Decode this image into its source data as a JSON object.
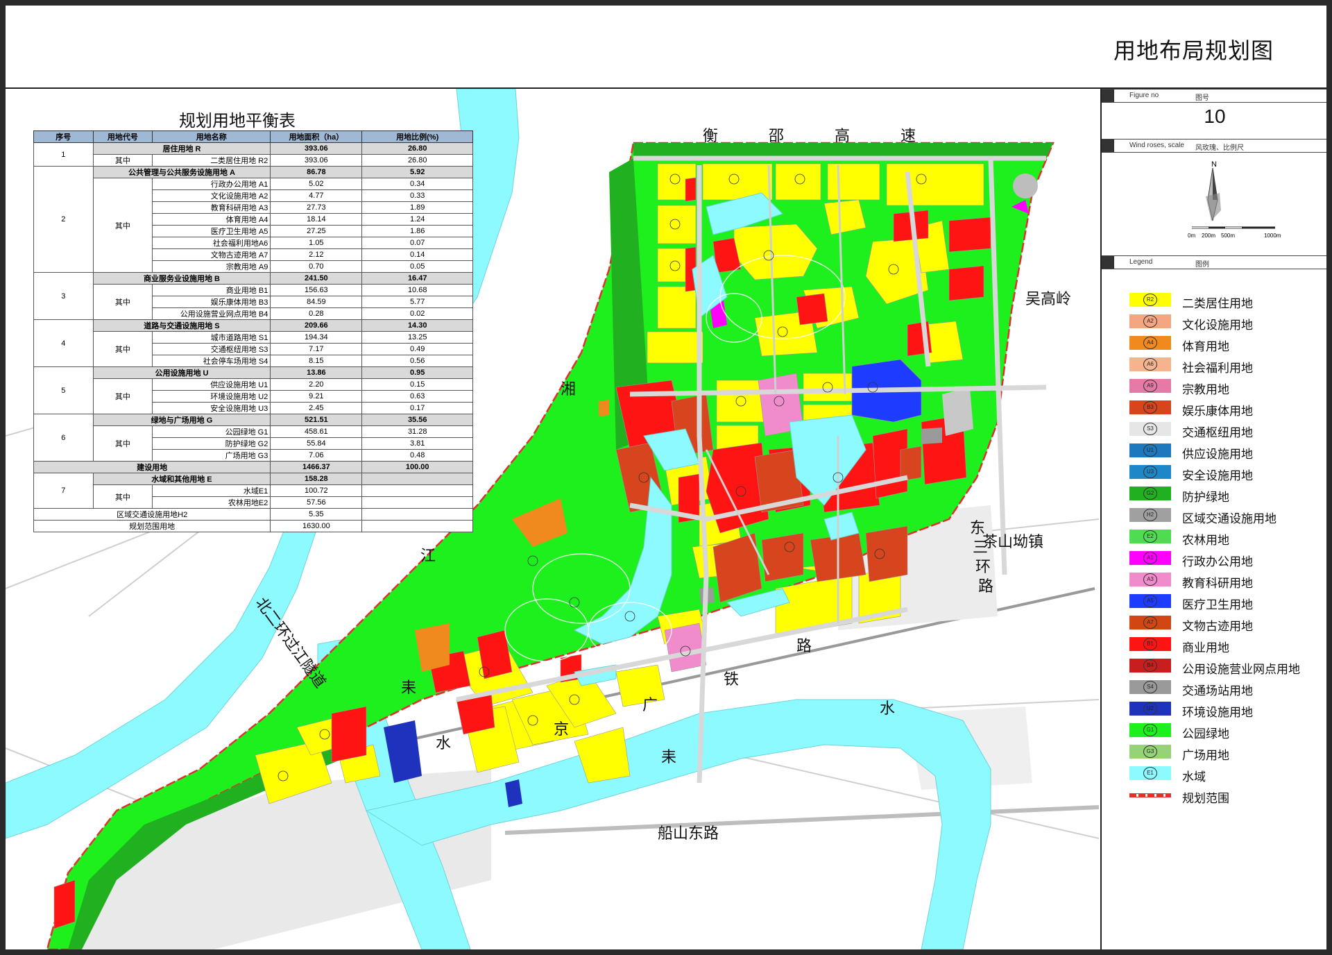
{
  "sheet_title": "用地布局规划图",
  "table": {
    "title": "规划用地平衡表",
    "headers": [
      "序号",
      "用地代号",
      "用地名称",
      "用地面积（ha）",
      "用地比例(%)"
    ],
    "rows": [
      {
        "type": "cat",
        "no": "1",
        "name": "居住用地 R",
        "area": "393.06",
        "ratio": "26.80"
      },
      {
        "type": "sub",
        "group": "其中",
        "name": "二类居住用地 R2",
        "area": "393.06",
        "ratio": "26.80"
      },
      {
        "type": "cat",
        "no": "2",
        "name": "公共管理与公共服务设施用地 A",
        "area": "86.78",
        "ratio": "5.92"
      },
      {
        "type": "sub",
        "group": "其中",
        "name": "行政办公用地 A1",
        "area": "5.02",
        "ratio": "0.34"
      },
      {
        "type": "sub",
        "name": "文化设施用地 A2",
        "area": "4.77",
        "ratio": "0.33"
      },
      {
        "type": "sub",
        "name": "教育科研用地 A3",
        "area": "27.73",
        "ratio": "1.89"
      },
      {
        "type": "sub",
        "name": "体育用地 A4",
        "area": "18.14",
        "ratio": "1.24"
      },
      {
        "type": "sub",
        "name": "医疗卫生用地 A5",
        "area": "27.25",
        "ratio": "1.86"
      },
      {
        "type": "sub",
        "name": "社会福利用地A6",
        "area": "1.05",
        "ratio": "0.07"
      },
      {
        "type": "sub",
        "name": "文物古迹用地 A7",
        "area": "2.12",
        "ratio": "0.14"
      },
      {
        "type": "sub",
        "name": "宗教用地 A9",
        "area": "0.70",
        "ratio": "0.05"
      },
      {
        "type": "cat",
        "no": "3",
        "name": "商业服务业设施用地 B",
        "area": "241.50",
        "ratio": "16.47"
      },
      {
        "type": "sub",
        "group": "其中",
        "name": "商业用地 B1",
        "area": "156.63",
        "ratio": "10.68"
      },
      {
        "type": "sub",
        "name": "娱乐康体用地 B3",
        "area": "84.59",
        "ratio": "5.77"
      },
      {
        "type": "sub",
        "name": "公用设施营业网点用地 B4",
        "area": "0.28",
        "ratio": "0.02"
      },
      {
        "type": "cat",
        "no": "4",
        "name": "道路与交通设施用地 S",
        "area": "209.66",
        "ratio": "14.30"
      },
      {
        "type": "sub",
        "group": "其中",
        "name": "城市道路用地 S1",
        "area": "194.34",
        "ratio": "13.25"
      },
      {
        "type": "sub",
        "name": "交通枢纽用地 S3",
        "area": "7.17",
        "ratio": "0.49"
      },
      {
        "type": "sub",
        "name": "社会停车场用地 S4",
        "area": "8.15",
        "ratio": "0.56"
      },
      {
        "type": "cat",
        "no": "5",
        "name": "公用设施用地 U",
        "area": "13.86",
        "ratio": "0.95"
      },
      {
        "type": "sub",
        "group": "其中",
        "name": "供应设施用地 U1",
        "area": "2.20",
        "ratio": "0.15"
      },
      {
        "type": "sub",
        "name": "环境设施用地 U2",
        "area": "9.21",
        "ratio": "0.63"
      },
      {
        "type": "sub",
        "name": "安全设施用地 U3",
        "area": "2.45",
        "ratio": "0.17"
      },
      {
        "type": "cat",
        "no": "6",
        "name": "绿地与广场用地 G",
        "area": "521.51",
        "ratio": "35.56"
      },
      {
        "type": "sub",
        "group": "其中",
        "name": "公园绿地 G1",
        "area": "458.61",
        "ratio": "31.28"
      },
      {
        "type": "sub",
        "name": "防护绿地 G2",
        "area": "55.84",
        "ratio": "3.81"
      },
      {
        "type": "sub",
        "name": "广场用地 G3",
        "area": "7.06",
        "ratio": "0.48"
      },
      {
        "type": "total",
        "name": "建设用地",
        "area": "1466.37",
        "ratio": "100.00"
      },
      {
        "type": "cat",
        "no": "7",
        "name": "水域和其他用地 E",
        "area": "158.28",
        "ratio": ""
      },
      {
        "type": "sub",
        "group": "其中",
        "name": "水域E1",
        "area": "100.72",
        "ratio": ""
      },
      {
        "type": "sub",
        "name": "农林用地E2",
        "area": "57.56",
        "ratio": ""
      },
      {
        "type": "plain",
        "name": "区域交通设施用地H2",
        "area": "5.35",
        "ratio": ""
      },
      {
        "type": "plain",
        "name": "规划范围用地",
        "area": "1630.00",
        "ratio": ""
      }
    ]
  },
  "panel": {
    "figure_no_en": "Figure no",
    "figure_no_cn": "图号",
    "figure_no": "10",
    "wind_en": "Wind roses, scale",
    "wind_cn": "风玫瑰、比例尺",
    "north": "N",
    "scale_ticks": [
      "0m",
      "200m",
      "500m",
      "1000m"
    ],
    "legend_en": "Legend",
    "legend_cn": "图例"
  },
  "legend": [
    {
      "code": "R2",
      "label": "二类居住用地",
      "color": "#ffff00"
    },
    {
      "code": "A2",
      "label": "文化设施用地",
      "color": "#f4a582"
    },
    {
      "code": "A4",
      "label": "体育用地",
      "color": "#f08a1e"
    },
    {
      "code": "A6",
      "label": "社会福利用地",
      "color": "#f6b48e"
    },
    {
      "code": "A9",
      "label": "宗教用地",
      "color": "#e67aa6"
    },
    {
      "code": "B3",
      "label": "娱乐康体用地",
      "color": "#d6451e"
    },
    {
      "code": "S3",
      "label": "交通枢纽用地",
      "color": "#e6e6e6"
    },
    {
      "code": "U1",
      "label": "供应设施用地",
      "color": "#1e78be"
    },
    {
      "code": "U3",
      "label": "安全设施用地",
      "color": "#1e87c8"
    },
    {
      "code": "G2",
      "label": "防护绿地",
      "color": "#20b020"
    },
    {
      "code": "H2",
      "label": "区域交通设施用地",
      "color": "#a0a0a0"
    },
    {
      "code": "E2",
      "label": "农林用地",
      "color": "#50dc50"
    },
    {
      "code": "A1",
      "label": "行政办公用地",
      "color": "#ff00ff"
    },
    {
      "code": "A3",
      "label": "教育科研用地",
      "color": "#f08ccc"
    },
    {
      "code": "A5",
      "label": "医疗卫生用地",
      "color": "#1e3cff"
    },
    {
      "code": "A7",
      "label": "文物古迹用地",
      "color": "#d24614"
    },
    {
      "code": "B1",
      "label": "商业用地",
      "color": "#ff1414"
    },
    {
      "code": "B4",
      "label": "公用设施营业网点用地",
      "color": "#c81e1e"
    },
    {
      "code": "S4",
      "label": "交通场站用地",
      "color": "#9a9a9a"
    },
    {
      "code": "U2",
      "label": "环境设施用地",
      "color": "#1e32be"
    },
    {
      "code": "G1",
      "label": "公园绿地",
      "color": "#1ef01e"
    },
    {
      "code": "G3",
      "label": "广场用地",
      "color": "#96d278"
    },
    {
      "code": "E1",
      "label": "水域",
      "color": "#8cfaff"
    }
  ],
  "legend_boundary": "规划范围",
  "map_labels": {
    "highway": [
      "衡",
      "邵",
      "高",
      "速"
    ],
    "xiang": [
      "湘",
      "江"
    ],
    "lei": [
      "耒",
      "水"
    ],
    "lei2": [
      "水",
      "耒"
    ],
    "wugaoling": "吴高岭",
    "chashanao": "茶山坳镇",
    "dongsanhuan": [
      "东",
      "三",
      "环",
      "路"
    ],
    "railway": [
      "路",
      "铁",
      "广",
      "京"
    ],
    "chuanshan": "船山东路",
    "tunnel": "北二环过江隧道"
  },
  "parcel_codes": [
    "R2",
    "B1",
    "B3",
    "A3",
    "A5",
    "G1",
    "E1",
    "A4",
    "G3",
    "S4",
    "H2",
    "S3",
    "E2",
    "A1",
    "A2",
    "U1"
  ]
}
